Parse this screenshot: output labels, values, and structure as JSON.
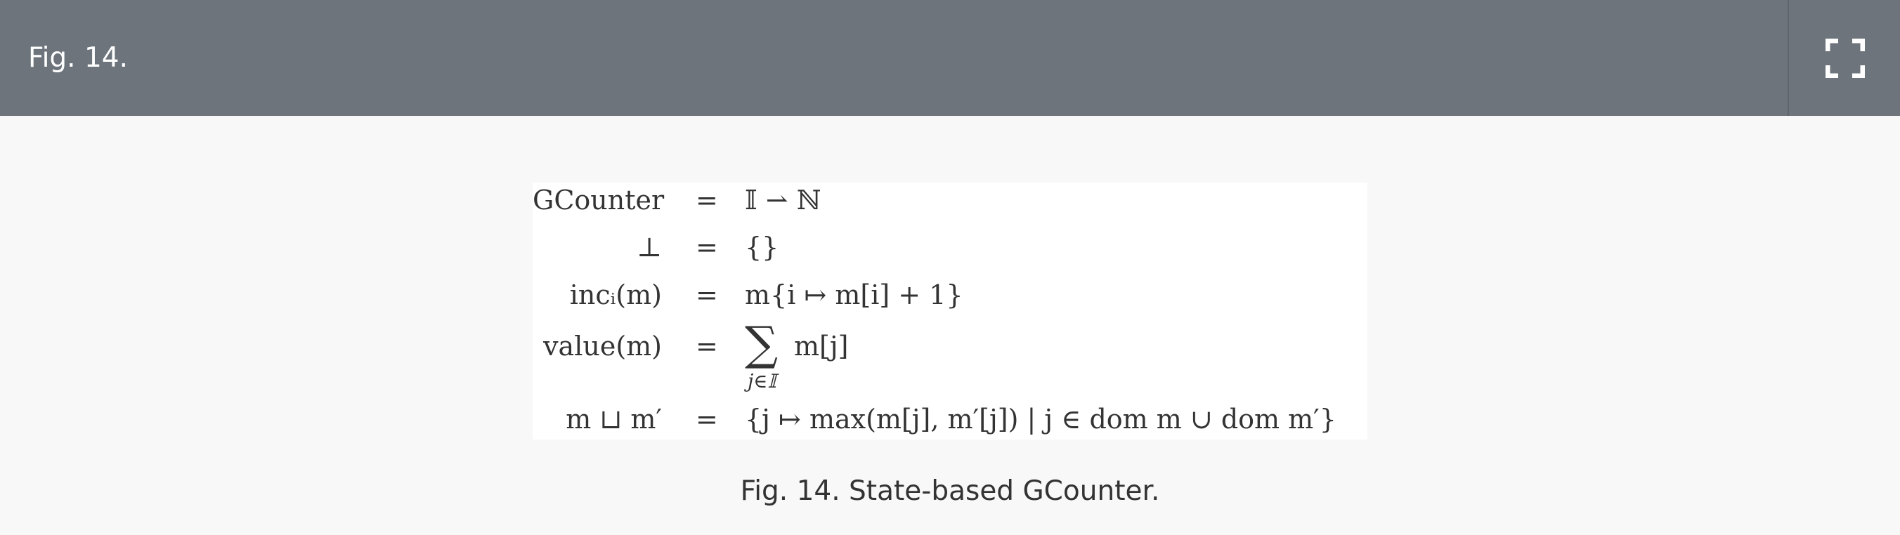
{
  "header": {
    "fig_label": "Fig. 14.",
    "fullscreen_icon": "fullscreen-icon"
  },
  "formula": {
    "rows": [
      {
        "lhs": "GCounter",
        "eq": "=",
        "rhs": "𝕀 ⇀ ℕ"
      },
      {
        "lhs": "⊥",
        "eq": "=",
        "rhs": "{}"
      },
      {
        "lhs": "incᵢ(m)",
        "eq": "=",
        "rhs": "m{i ↦ m[i] + 1}"
      },
      {
        "lhs": "value(m)",
        "eq": "=",
        "sum_symbol": "∑",
        "sum_sub": "j∈𝕀",
        "rhs": "m[j]"
      },
      {
        "lhs": "m ⊔ m′",
        "eq": "=",
        "rhs": "{j ↦ max(m[j], m′[j]) | j ∈ dom m ∪ dom m′}"
      }
    ]
  },
  "caption": {
    "label": "Fig. 14.",
    "text": " State-based GCounter."
  }
}
